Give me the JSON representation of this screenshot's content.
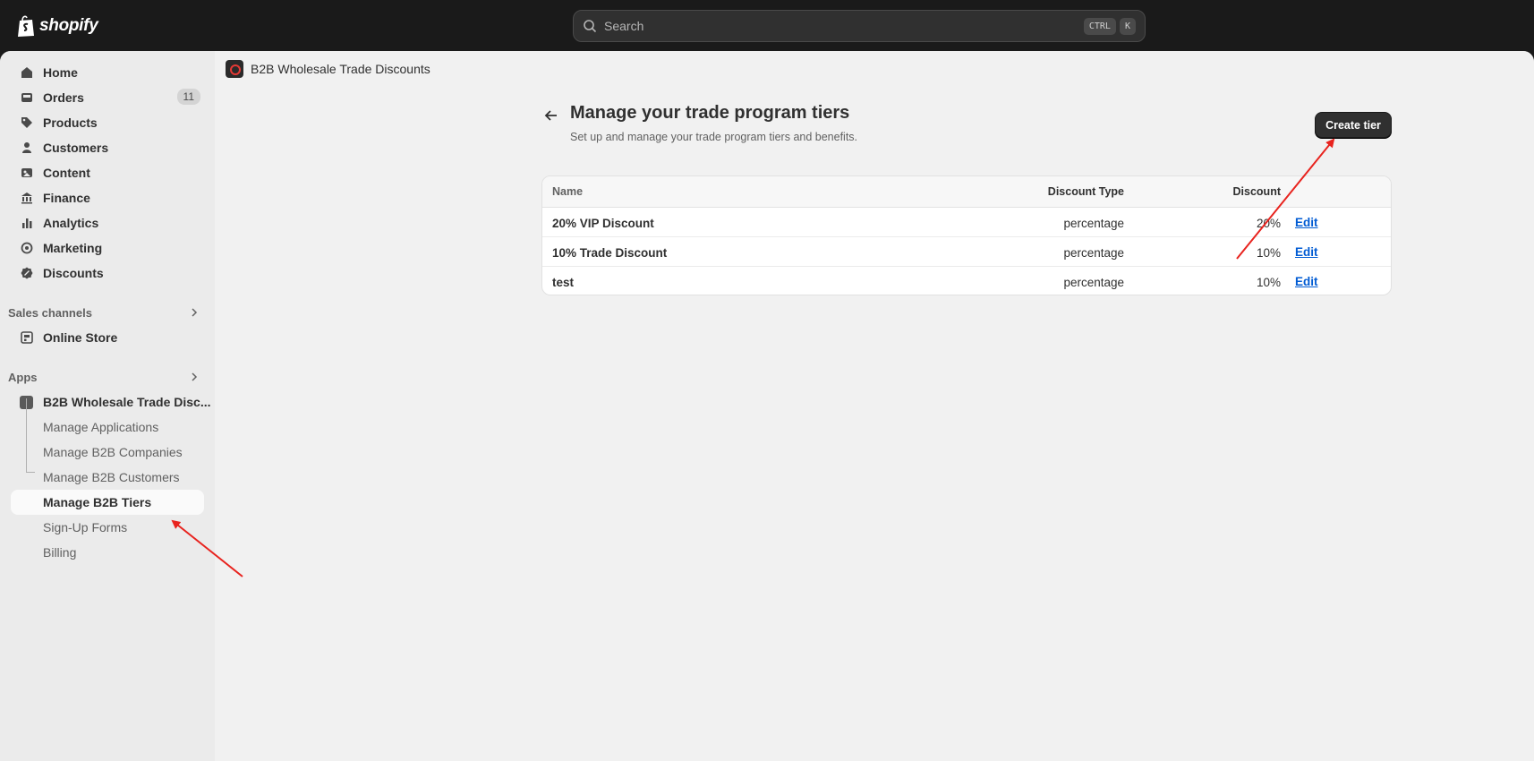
{
  "topbar": {
    "brand": "shopify",
    "search_placeholder": "Search",
    "shortcut_keys": [
      "CTRL",
      "K"
    ]
  },
  "sidebar": {
    "nav": [
      {
        "label": "Home",
        "icon": "home-icon"
      },
      {
        "label": "Orders",
        "icon": "inbox-icon",
        "badge": "11"
      },
      {
        "label": "Products",
        "icon": "tag-icon"
      },
      {
        "label": "Customers",
        "icon": "person-icon"
      },
      {
        "label": "Content",
        "icon": "image-icon"
      },
      {
        "label": "Finance",
        "icon": "bank-icon"
      },
      {
        "label": "Analytics",
        "icon": "bar-chart-icon"
      },
      {
        "label": "Marketing",
        "icon": "target-icon"
      },
      {
        "label": "Discounts",
        "icon": "discount-icon"
      }
    ],
    "sales_channels_label": "Sales channels",
    "online_store_label": "Online Store",
    "apps_label": "Apps",
    "app_name": "B2B Wholesale Trade Disc...",
    "app_subitems": [
      "Manage Applications",
      "Manage B2B Companies",
      "Manage B2B Customers",
      "Manage B2B Tiers",
      "Sign-Up Forms",
      "Billing"
    ],
    "active_subitem": "Manage B2B Tiers"
  },
  "app_header": {
    "title": "B2B Wholesale Trade Discounts"
  },
  "page": {
    "title": "Manage your trade program tiers",
    "subtitle": "Set up and manage your trade program tiers and benefits.",
    "create_button": "Create tier"
  },
  "table": {
    "headers": {
      "name": "Name",
      "type": "Discount Type",
      "discount": "Discount"
    },
    "rows": [
      {
        "name": "20% VIP Discount",
        "type": "percentage",
        "discount": "20%",
        "action": "Edit"
      },
      {
        "name": "10% Trade Discount",
        "type": "percentage",
        "discount": "10%",
        "action": "Edit"
      },
      {
        "name": "test",
        "type": "percentage",
        "discount": "10%",
        "action": "Edit"
      }
    ]
  },
  "colors": {
    "annotation_arrow": "#e8231e",
    "link": "#005bd3",
    "primary_button": "#303030"
  }
}
